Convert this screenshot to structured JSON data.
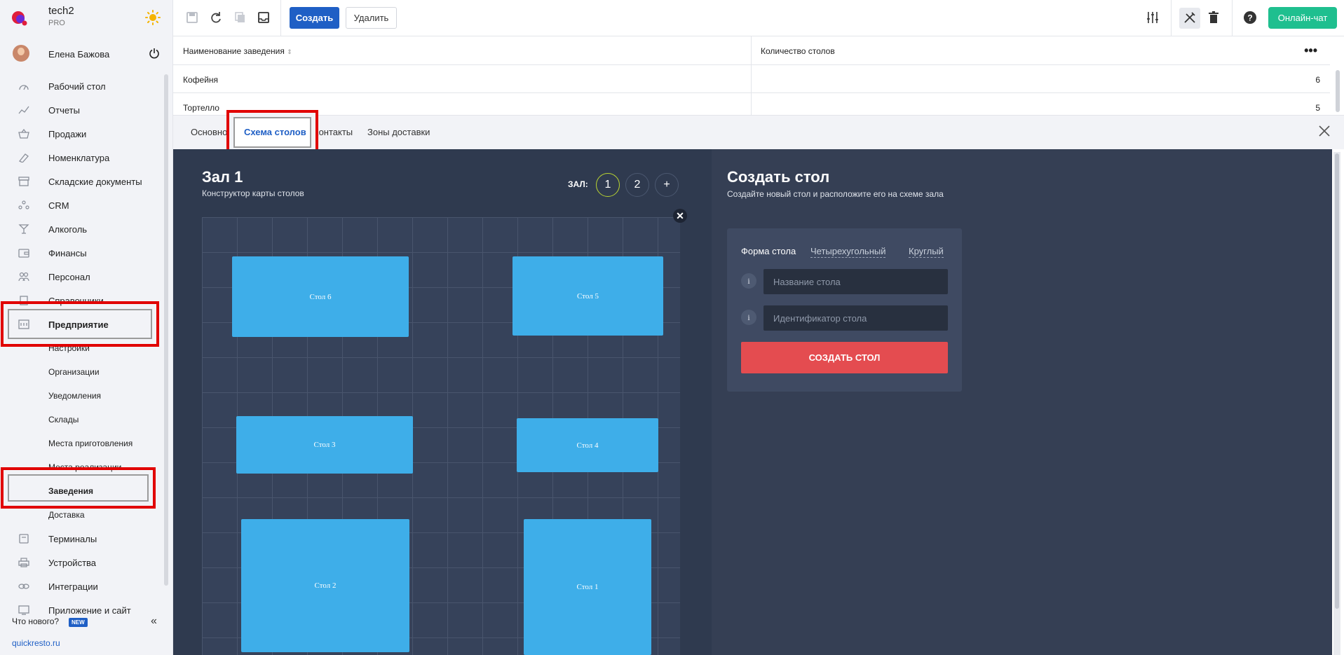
{
  "brand": {
    "name": "tech2",
    "plan": "PRO"
  },
  "user": {
    "name": "Елена Бажова"
  },
  "sidebar": {
    "items": [
      {
        "label": "Рабочий стол",
        "icon": "dashboard-icon"
      },
      {
        "label": "Отчеты",
        "icon": "chart-icon"
      },
      {
        "label": "Продажи",
        "icon": "basket-icon"
      },
      {
        "label": "Номенклатура",
        "icon": "tag-icon"
      },
      {
        "label": "Складские документы",
        "icon": "box-icon"
      },
      {
        "label": "CRM",
        "icon": "people-icon"
      },
      {
        "label": "Алкоголь",
        "icon": "glass-icon"
      },
      {
        "label": "Финансы",
        "icon": "wallet-icon"
      },
      {
        "label": "Персонал",
        "icon": "staff-icon"
      },
      {
        "label": "Справочники",
        "icon": "book-icon"
      },
      {
        "label": "Предприятие",
        "icon": "building-icon"
      }
    ],
    "subitems": [
      "Настройки",
      "Организации",
      "Уведомления",
      "Склады",
      "Места приготовления",
      "Места реализации",
      "Заведения",
      "Доставка"
    ],
    "items_bottom": [
      {
        "label": "Терминалы",
        "icon": "terminal-icon"
      },
      {
        "label": "Устройства",
        "icon": "printer-icon"
      },
      {
        "label": "Интеграции",
        "icon": "link-icon"
      },
      {
        "label": "Приложение и сайт",
        "icon": "app-icon"
      }
    ],
    "whats_new": "Что нового?",
    "new_badge": "NEW",
    "site_link": "quickresto.ru"
  },
  "toolbar": {
    "create_label": "Создать",
    "delete_label": "Удалить",
    "chat_label": "Онлайн-чат"
  },
  "table": {
    "columns": [
      "Наименование заведения",
      "Количество столов"
    ],
    "rows": [
      {
        "name": "Кофейня",
        "count": "6"
      },
      {
        "name": "Тортелло",
        "count": "5"
      }
    ]
  },
  "tabs": [
    "Основное",
    "Схема столов",
    "Контакты",
    "Зоны доставки"
  ],
  "hall": {
    "title": "Зал 1",
    "subtitle": "Конструктор карты столов",
    "selector_label": "ЗАЛ:",
    "halls": [
      "1",
      "2",
      "+"
    ],
    "close_glyph": "✕",
    "tables": [
      "Стол 6",
      "Стол 5",
      "Стол 3",
      "Стол 4",
      "Стол 2",
      "Стол 1"
    ]
  },
  "create_panel": {
    "title": "Создать стол",
    "subtitle": "Создайте новый стол и расположите его на схеме зала",
    "shape_label": "Форма стола",
    "shape_options": [
      "Четырехугольный",
      "Круглый"
    ],
    "info_glyph": "i",
    "name_placeholder": "Название стола",
    "id_placeholder": "Идентификатор стола",
    "submit_label": "СОЗДАТЬ СТОЛ"
  },
  "colors": {
    "accent": "#1f5fc5",
    "chat": "#1fbf8f",
    "table_fill": "#3eaee9",
    "danger": "#e44c50",
    "highlight": "#e10000"
  }
}
